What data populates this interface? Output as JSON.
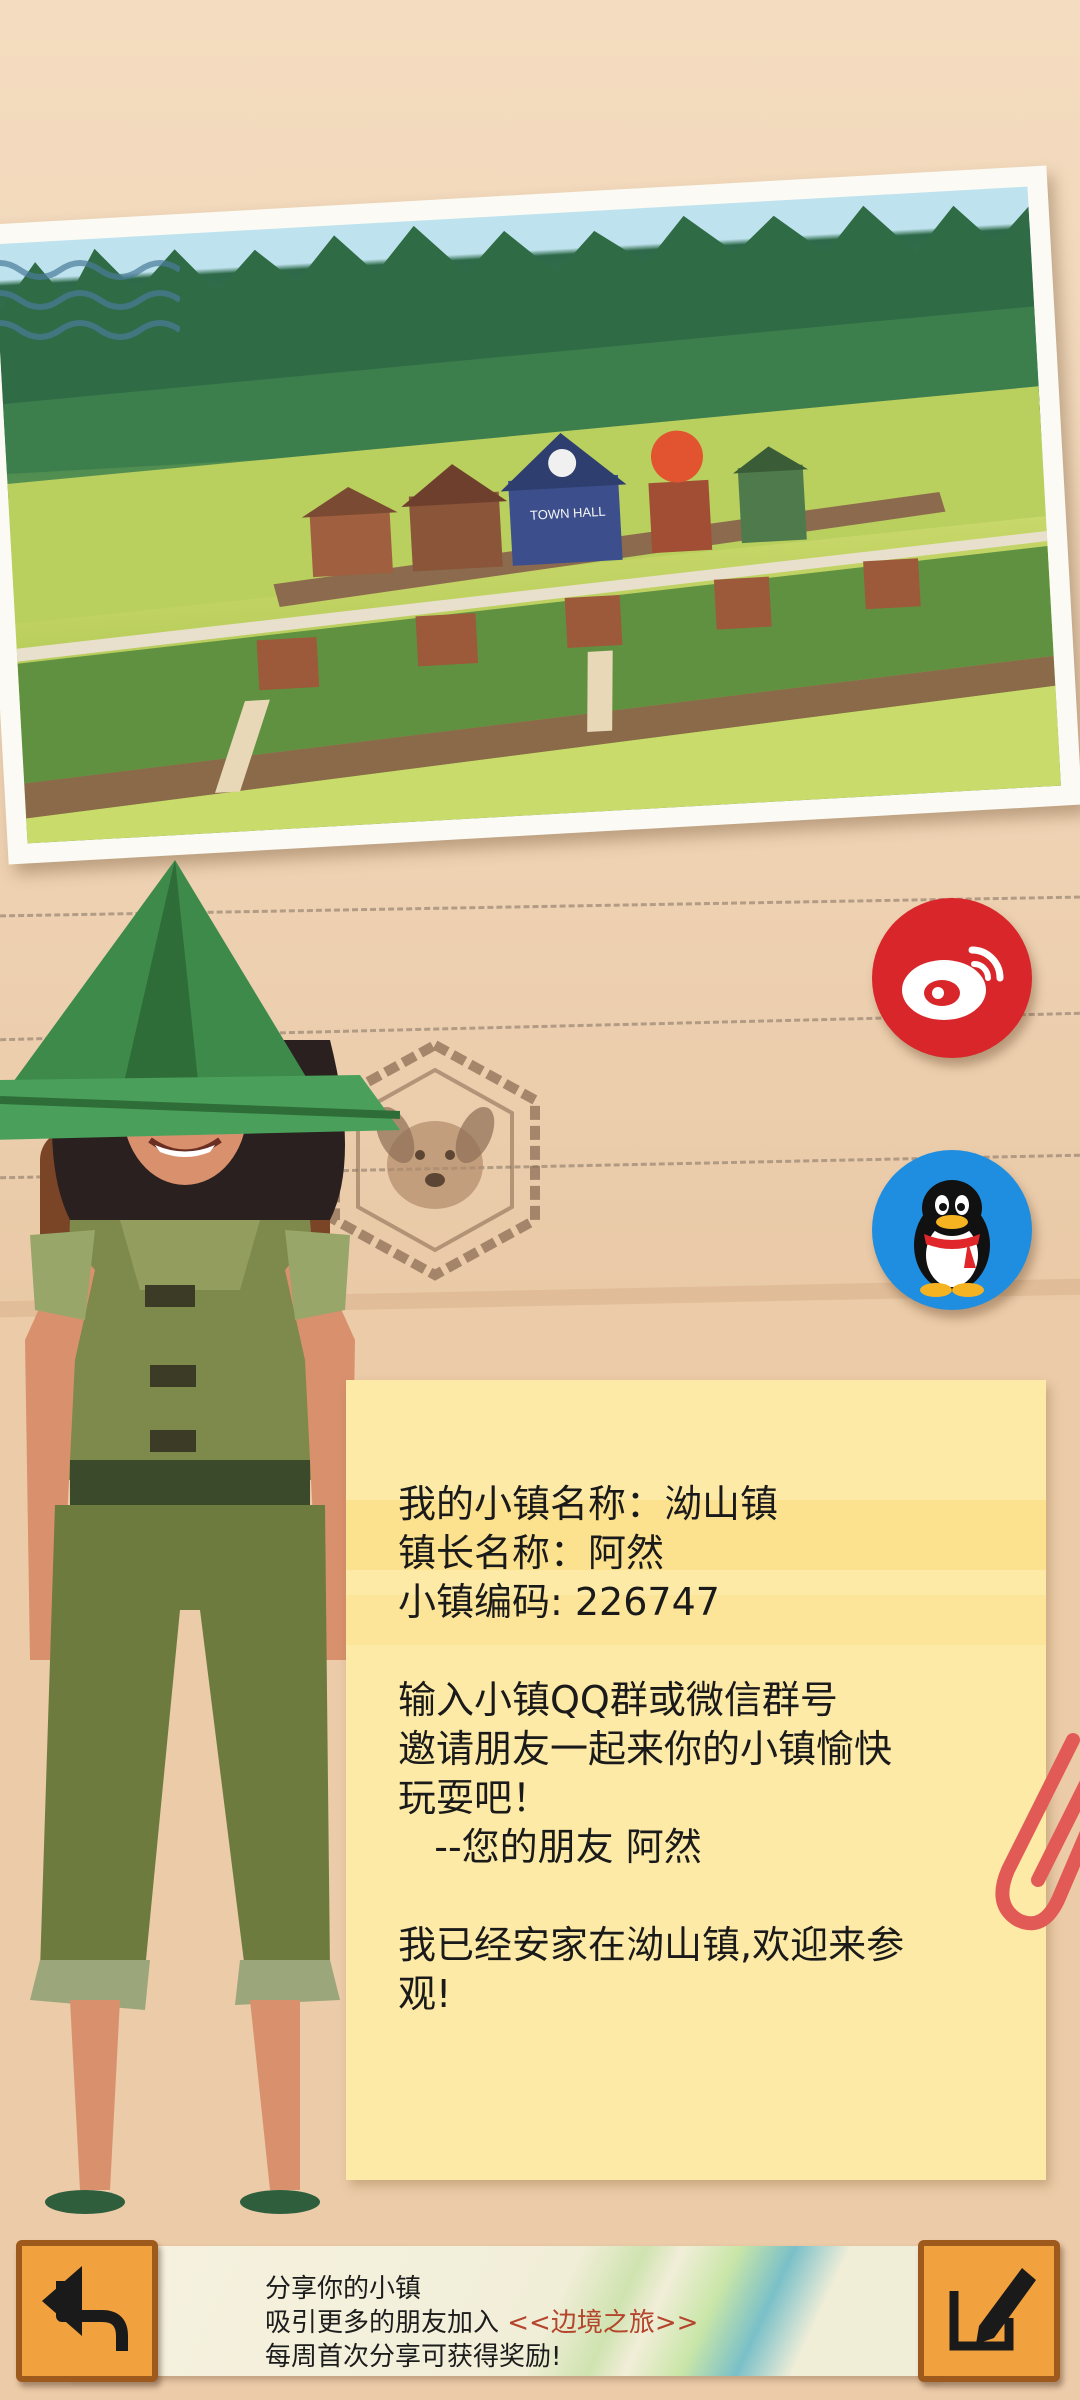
{
  "town_card": {
    "lines": [
      "我的小镇名称：泑山镇",
      "镇长名称：阿然",
      "小镇编码: 226747",
      "",
      "输入小镇QQ群或微信群号",
      "邀请朋友一起来你的小镇愉快",
      "玩耍吧！",
      "   --您的朋友 阿然",
      "",
      "我已经安家在泑山镇,欢迎来参",
      "观!"
    ]
  },
  "share_bar": {
    "line1": "分享你的小镇",
    "line2_prefix": "吸引更多的朋友加入 ",
    "line2_highlight": "<<边境之旅>>",
    "line3": "每周首次分享可获得奖励!"
  },
  "photo": {
    "sign": "TOWN HALL"
  },
  "icons": {
    "weibo": "weibo-icon",
    "qq": "qq-penguin-icon",
    "back": "back-arrow-icon",
    "edit": "edit-pencil-icon",
    "stamp": "dog-paw-stamp-icon"
  },
  "colors": {
    "weibo_red": "#d8262b",
    "qq_blue": "#1f8ee0",
    "button_orange": "#f1a23e",
    "note_yellow": "#fdeaa6",
    "highlight_text": "#b5442c"
  }
}
